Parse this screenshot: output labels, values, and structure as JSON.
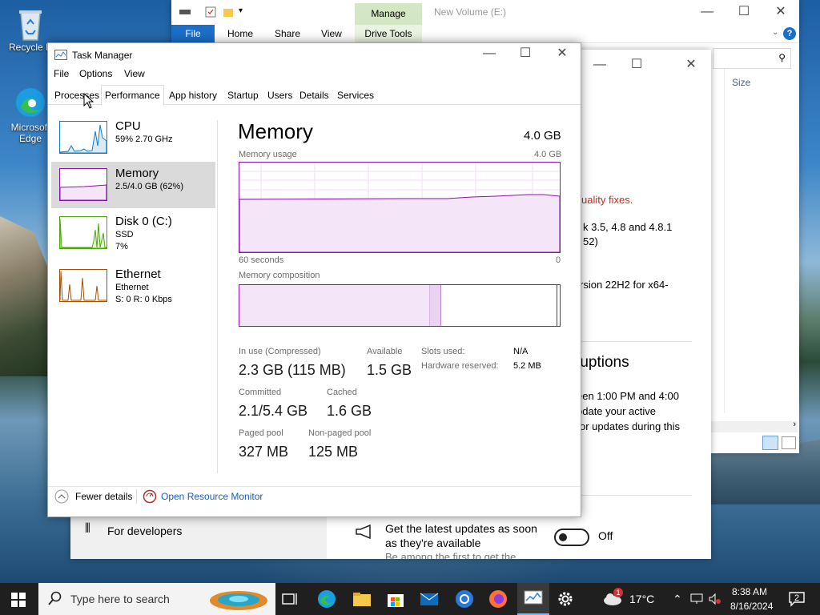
{
  "desktop": {
    "icons": [
      {
        "label": "Recycle Bin"
      },
      {
        "label": "Microsoft Edge"
      }
    ],
    "edge_label_line1": "Microsoft",
    "edge_label_line2": "Edge",
    "recycle_label": "Recycle B"
  },
  "explorer": {
    "title": "New Volume (E:)",
    "ribbon_tabs": [
      "File",
      "Home",
      "Share",
      "View"
    ],
    "manage_label": "Manage",
    "drive_tools_label": "Drive Tools",
    "column_header": "Size"
  },
  "settings": {
    "text_quality": "uality fixes.",
    "text_net1": "k 3.5, 4.8 and 4.8.1",
    "text_net2": "52)",
    "text_version": "rsion 22H2 for x64-",
    "heading": "ruptions",
    "text_p1": "een 1:00 PM and 4:00",
    "text_p2": "pdate your active",
    "text_p3": "or updates during this",
    "for_developers": "For developers",
    "latest_updates_1": "Get the latest updates as soon",
    "latest_updates_2": "as they're available",
    "latest_updates_3": "Be among the first to get the",
    "toggle_state": "Off"
  },
  "task_manager": {
    "title": "Task Manager",
    "menu": [
      "File",
      "Options",
      "View"
    ],
    "tabs": [
      "Processes",
      "Performance",
      "App history",
      "Startup",
      "Users",
      "Details",
      "Services"
    ],
    "active_tab": "Performance",
    "sidebar": [
      {
        "name": "CPU",
        "sub1": "59%  2.70 GHz",
        "sub2": "",
        "color": "#117dbb"
      },
      {
        "name": "Memory",
        "sub1": "2.5/4.0 GB (62%)",
        "sub2": "",
        "color": "#8b12ae"
      },
      {
        "name": "Disk 0 (C:)",
        "sub1": "SSD",
        "sub2": "7%",
        "color": "#4da60c"
      },
      {
        "name": "Ethernet",
        "sub1": "Ethernet",
        "sub2": "S: 0  R: 0 Kbps",
        "color": "#a74f01"
      }
    ],
    "detail": {
      "heading": "Memory",
      "total": "4.0 GB",
      "usage_label": "Memory usage",
      "usage_max": "4.0 GB",
      "axis_left": "60 seconds",
      "axis_right": "0",
      "composition_label": "Memory composition",
      "in_use_label": "In use (Compressed)",
      "in_use_value": "2.3 GB (115 MB)",
      "available_label": "Available",
      "available_value": "1.5 GB",
      "committed_label": "Committed",
      "committed_value": "2.1/5.4 GB",
      "cached_label": "Cached",
      "cached_value": "1.6 GB",
      "paged_label": "Paged pool",
      "paged_value": "327 MB",
      "nonpaged_label": "Non-paged pool",
      "nonpaged_value": "125 MB",
      "slots_label": "Slots used:",
      "slots_value": "N/A",
      "hw_label": "Hardware reserved:",
      "hw_value": "5.2 MB",
      "composition_fractions": {
        "in_use": 0.59,
        "modified": 0.04,
        "standby": 0.37
      }
    },
    "footer": {
      "fewer_details": "Fewer details",
      "open_resource_monitor": "Open Resource Monitor"
    }
  },
  "taskbar": {
    "search_placeholder": "Type here to search",
    "weather": "17°C",
    "time": "8:38 AM",
    "date": "8/16/2024",
    "notification_count": "2",
    "weather_badge": "1"
  },
  "colors": {
    "memory_accent": "#8b12ae",
    "explorer_file_tab": "#1a6fc9",
    "manage_highlight": "#d4e7c4"
  }
}
